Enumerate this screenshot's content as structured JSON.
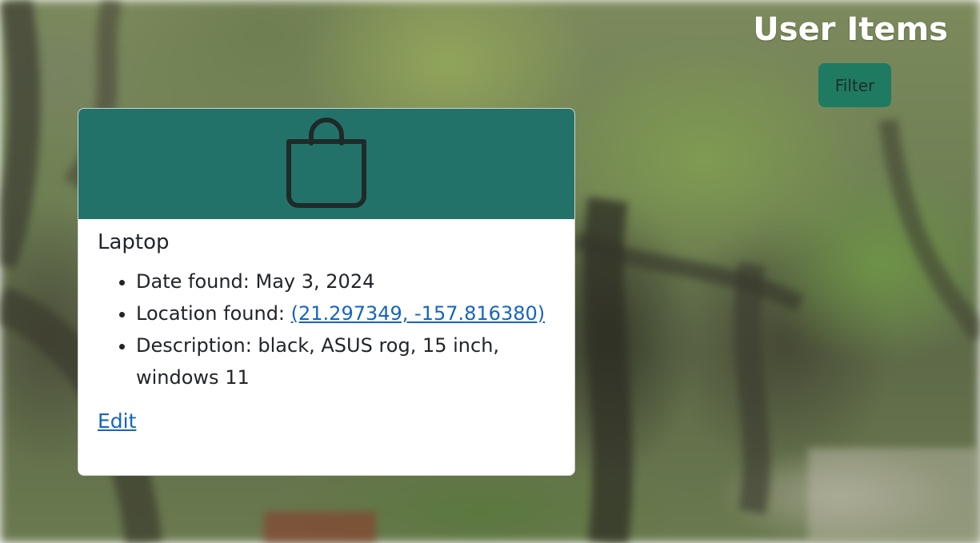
{
  "page": {
    "title": "User Items"
  },
  "toolbar": {
    "filter_label": "Filter"
  },
  "item_card": {
    "icon": "shopping-bag-icon",
    "name": "Laptop",
    "date_found_label": "Date found: ",
    "date_found": "May 3, 2024",
    "location_found_label": "Location found: ",
    "location_found": "(21.297349, -157.816380)",
    "description_label": "Description: ",
    "description": "black, ASUS rog, 15 inch, windows 11",
    "edit_label": "Edit"
  },
  "colors": {
    "card_header": "#22726a",
    "filter_button": "#1f7a62",
    "link": "#1565c0"
  }
}
